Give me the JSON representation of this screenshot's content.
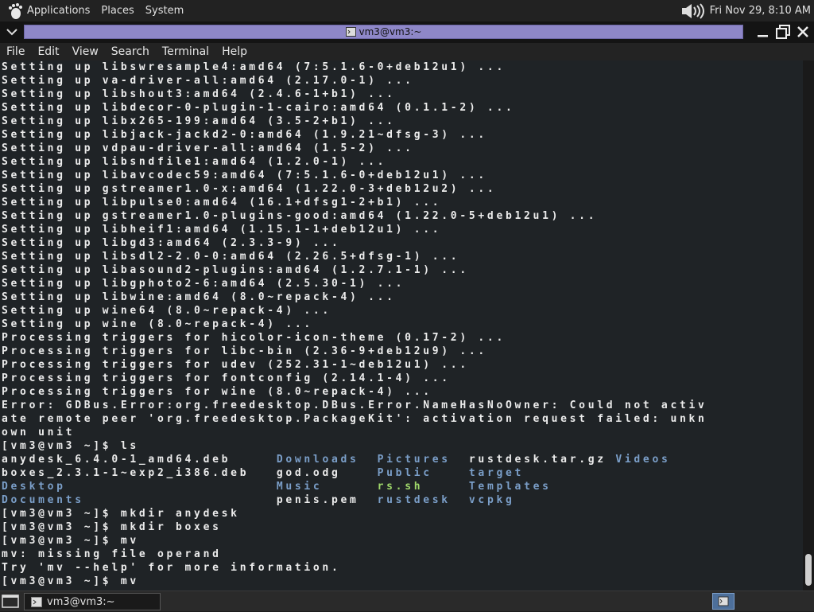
{
  "top_panel": {
    "menus": [
      "Applications",
      "Places",
      "System"
    ],
    "datetime": "Fri Nov 29,  8:10 AM"
  },
  "window": {
    "title": "vm3@vm3:~"
  },
  "menubar": [
    "File",
    "Edit",
    "View",
    "Search",
    "Terminal",
    "Help"
  ],
  "terminal": {
    "lines": [
      "Setting up libswresample4:amd64 (7:5.1.6-0+deb12u1) ...",
      "Setting up va-driver-all:amd64 (2.17.0-1) ...",
      "Setting up libshout3:amd64 (2.4.6-1+b1) ...",
      "Setting up libdecor-0-plugin-1-cairo:amd64 (0.1.1-2) ...",
      "Setting up libx265-199:amd64 (3.5-2+b1) ...",
      "Setting up libjack-jackd2-0:amd64 (1.9.21~dfsg-3) ...",
      "Setting up vdpau-driver-all:amd64 (1.5-2) ...",
      "Setting up libsndfile1:amd64 (1.2.0-1) ...",
      "Setting up libavcodec59:amd64 (7:5.1.6-0+deb12u1) ...",
      "Setting up gstreamer1.0-x:amd64 (1.22.0-3+deb12u2) ...",
      "Setting up libpulse0:amd64 (16.1+dfsg1-2+b1) ...",
      "Setting up gstreamer1.0-plugins-good:amd64 (1.22.0-5+deb12u1) ...",
      "Setting up libheif1:amd64 (1.15.1-1+deb12u1) ...",
      "Setting up libgd3:amd64 (2.3.3-9) ...",
      "Setting up libsdl2-2.0-0:amd64 (2.26.5+dfsg-1) ...",
      "Setting up libasound2-plugins:amd64 (1.2.7.1-1) ...",
      "Setting up libgphoto2-6:amd64 (2.5.30-1) ...",
      "Setting up libwine:amd64 (8.0~repack-4) ...",
      "Setting up wine64 (8.0~repack-4) ...",
      "Setting up wine (8.0~repack-4) ...",
      "Processing triggers for hicolor-icon-theme (0.17-2) ...",
      "Processing triggers for libc-bin (2.36-9+deb12u9) ...",
      "Processing triggers for udev (252.31-1~deb12u1) ...",
      "Processing triggers for fontconfig (2.14.1-4) ...",
      "Processing triggers for wine (8.0~repack-4) ...",
      "Error: GDBus.Error:org.freedesktop.DBus.Error.NameHasNoOwner: Could not activ",
      "ate remote peer 'org.freedesktop.PackageKit': activation request failed: unkn",
      "own unit",
      "[vm3@vm3 ~]$ ls"
    ],
    "ls_rows": [
      [
        {
          "text": "anydesk_6.4.0-1_amd64.deb",
          "kind": "file"
        },
        {
          "text": "Downloads",
          "kind": "dir"
        },
        {
          "text": "Pictures",
          "kind": "dir"
        },
        {
          "text": "rustdesk.tar.gz",
          "kind": "file"
        },
        {
          "text": "Videos",
          "kind": "dir"
        }
      ],
      [
        {
          "text": "boxes_2.3.1-1~exp2_i386.deb",
          "kind": "file"
        },
        {
          "text": "god.odg",
          "kind": "file"
        },
        {
          "text": "Public",
          "kind": "dir"
        },
        {
          "text": "target",
          "kind": "dir"
        },
        {
          "text": "",
          "kind": "file"
        }
      ],
      [
        {
          "text": "Desktop",
          "kind": "dir"
        },
        {
          "text": "Music",
          "kind": "dir"
        },
        {
          "text": "rs.sh",
          "kind": "exe"
        },
        {
          "text": "Templates",
          "kind": "dir"
        },
        {
          "text": "",
          "kind": "file"
        }
      ],
      [
        {
          "text": "Documents",
          "kind": "dir"
        },
        {
          "text": "penis.pem",
          "kind": "file"
        },
        {
          "text": "rustdesk",
          "kind": "dir"
        },
        {
          "text": "vcpkg",
          "kind": "dir"
        },
        {
          "text": "",
          "kind": "file"
        }
      ]
    ],
    "after_lines": [
      "[vm3@vm3 ~]$ mkdir anydesk",
      "[vm3@vm3 ~]$ mkdir boxes",
      "[vm3@vm3 ~]$ mv",
      "mv: missing file operand",
      "Try 'mv --help' for more information.",
      "[vm3@vm3 ~]$ mv"
    ]
  },
  "taskbar": {
    "window_button": "vm3@vm3:~"
  }
}
